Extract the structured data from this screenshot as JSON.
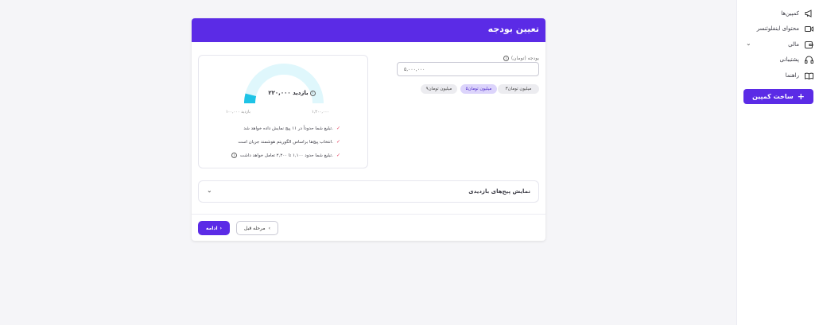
{
  "sidebar": {
    "items": [
      {
        "label": "کمپین‌ها",
        "icon": "megaphone-icon"
      },
      {
        "label": "محتوای اینفلوئنسر",
        "icon": "video-icon"
      },
      {
        "label": "مالی",
        "icon": "wallet-icon"
      },
      {
        "label": "پشتیبانی",
        "icon": "headphones-icon"
      },
      {
        "label": "راهنما",
        "icon": "book-icon"
      }
    ],
    "create_button": "ساخت کمپین"
  },
  "card": {
    "title": "تعیین بودجه"
  },
  "gauge": {
    "value_text": "۲۲۰,۰۰۰ بازدید",
    "min_text": "۱۰۰,۰۰۰ بازدید",
    "max_text": "۱,۲۰۰,۰۰۰",
    "fill_fraction": 0.08,
    "track_color": "#dff7fc",
    "fill_color": "#1ec3e6"
  },
  "bullets": [
    "تبلیغ شما حدوداً در ۱۱ پیج نمایش داده خواهد شد.",
    "انتخاب پیج‌ها براساس الگوریتم هوشمند جریان است.",
    "تبلیغ شما حدود ۱,۱۰۰ تا ۲,۲۰۰ تعامل خواهد داشت."
  ],
  "budget": {
    "label": "بودجه (تومان)",
    "value": "۵,۰۰۰,۰۰۰",
    "chips": [
      "۳میلیون تومان",
      "۵میلیون تومان",
      "۹میلیون تومان"
    ],
    "active_chip": 1
  },
  "accordion": {
    "title": "نمایش پیج‌های بازدیدی"
  },
  "actions": {
    "next": "ادامه",
    "prev": "مرحله قبل"
  },
  "colors": {
    "accent": "#5b2be6",
    "check": "#e33a5a"
  }
}
